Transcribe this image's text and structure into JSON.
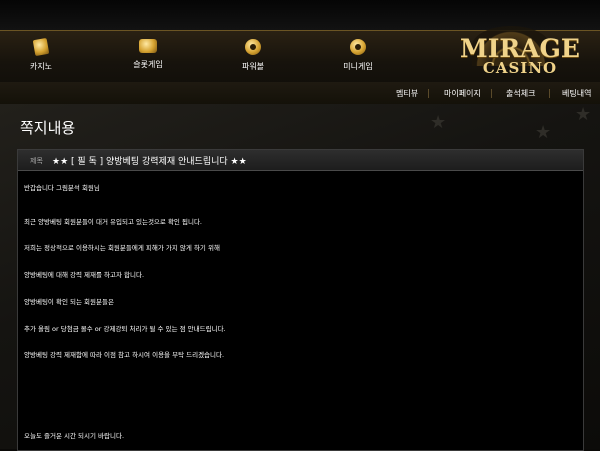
{
  "nav": {
    "items": [
      {
        "label": "카지노",
        "icon": "cards-icon"
      },
      {
        "label": "슬롯게임",
        "icon": "slot-icon"
      },
      {
        "label": "파워볼",
        "icon": "powerball-icon"
      },
      {
        "label": "미니게임",
        "icon": "minigame-icon"
      }
    ]
  },
  "logo": {
    "main": "MIRAGE",
    "sub": "CASINO"
  },
  "subnav": {
    "items": [
      "멤티뷰",
      "마이페이지",
      "출석체크",
      "베팅내역"
    ]
  },
  "page": {
    "title": "쪽지내용"
  },
  "message": {
    "subject_label": "제목",
    "subject": "★★ [ 필 독 ] 양방베팅 강력제재 안내드립니다 ★★",
    "lines": [
      "반갑습니다 그림분석 회원님",
      "최근 양방베팅 회원분들이 대거 유입되고 있는것으로 확인 됩니다.",
      "저희는 정상적으로 이용하시는 회원분들에게 피해가 가지 않게 하기 위해",
      "양방베팅에 대해 강력 제재를 하고자 합니다.",
      "양방베팅이 확인 되는 회원분들은",
      "추가 올림 or 당첨금 몰수 or 강제강퇴 처리가 될 수 있는 점 안내드립니다.",
      "양방베팅 강력 제재함에 따라 이점 참고 하시여 이용을 부탁 드리겠습니다.",
      "오늘도 즐거운 시간 되시기 바랍니다."
    ]
  },
  "colors": {
    "gold": "#d5a230",
    "panel_bg": "#000000",
    "header_bg": "#2e2e2e"
  }
}
